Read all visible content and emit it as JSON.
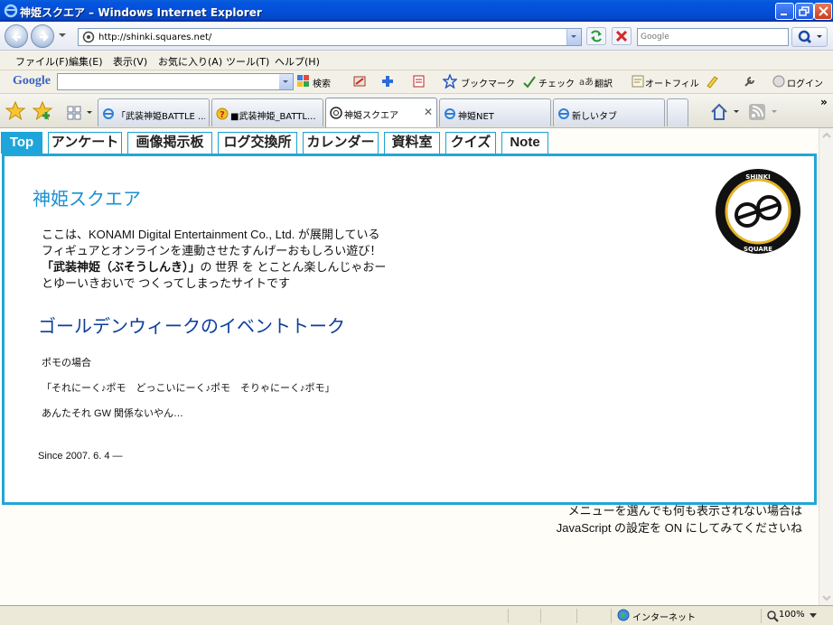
{
  "window": {
    "title": "神姫スクエア – Windows Internet Explorer"
  },
  "address": {
    "url": "http://shinki.squares.net/"
  },
  "search": {
    "placeholder": "Google"
  },
  "menu": {
    "items": [
      "ファイル(F)",
      "編集(E)",
      "表示(V)",
      "お気に入り(A)",
      "ツール(T)",
      "ヘルプ(H)"
    ]
  },
  "google_toolbar": {
    "logo": "Google",
    "search_label": "検索",
    "bookmark_label": "ブックマーク",
    "check_label": "チェック",
    "translate_label": "翻訳",
    "autofill_label": "オートフィル",
    "login_label": "ログイン"
  },
  "tabs": [
    {
      "label": "「武装神姫BATTLE ...",
      "icon": "ie-page-icon"
    },
    {
      "label": "■武装神姫_BATTL...",
      "icon": "question-icon"
    },
    {
      "label": "神姫スクエア",
      "icon": "site-icon",
      "active": true
    },
    {
      "label": "神姫NET",
      "icon": "ie-page-icon"
    },
    {
      "label": "新しいタブ",
      "icon": "ie-page-icon"
    }
  ],
  "site_nav": [
    "Top",
    "アンケート",
    "画像掲示板",
    "ログ交換所",
    "カレンダー",
    "資料室",
    "クイズ",
    "Note"
  ],
  "content": {
    "title": "神姫スクエア",
    "intro_1": "ここは、KONAMI Digital Entertainment Co., Ltd. が展開している",
    "intro_2": "フィギュアとオンラインを連動させたすんげーおもしろい遊び！",
    "intro_3_bold": "「武装神姫（ぶそうしんき）」",
    "intro_3_rest": "の 世界 を とことん楽しんじゃおー",
    "intro_4": "とゆーいきおいで つくってしまったサイトです",
    "event_title": "ゴールデンウィークのイベントトーク",
    "talk_1": "ポモの場合",
    "talk_2": "「それにーく♪ポモ　どっこいにーく♪ポモ　そりゃにーく♪ポモ」",
    "talk_3": "あんたそれ GW 関係ないやん…",
    "since": "Since 2007. 6. 4 ―"
  },
  "logo": {
    "top_text": "SHINKI",
    "bottom_text": "SQUARE"
  },
  "footer_note": {
    "line_1": "メニューを選んでも何も表示されない場合は",
    "line_2": "JavaScript の設定を ON にしてみてくださいね"
  },
  "status": {
    "zone": "インターネット",
    "zoom": "100%"
  },
  "colors": {
    "accent": "#1ea6dc",
    "title_blue": "#1b8fd4",
    "heading_navy": "#0d3e9a"
  }
}
